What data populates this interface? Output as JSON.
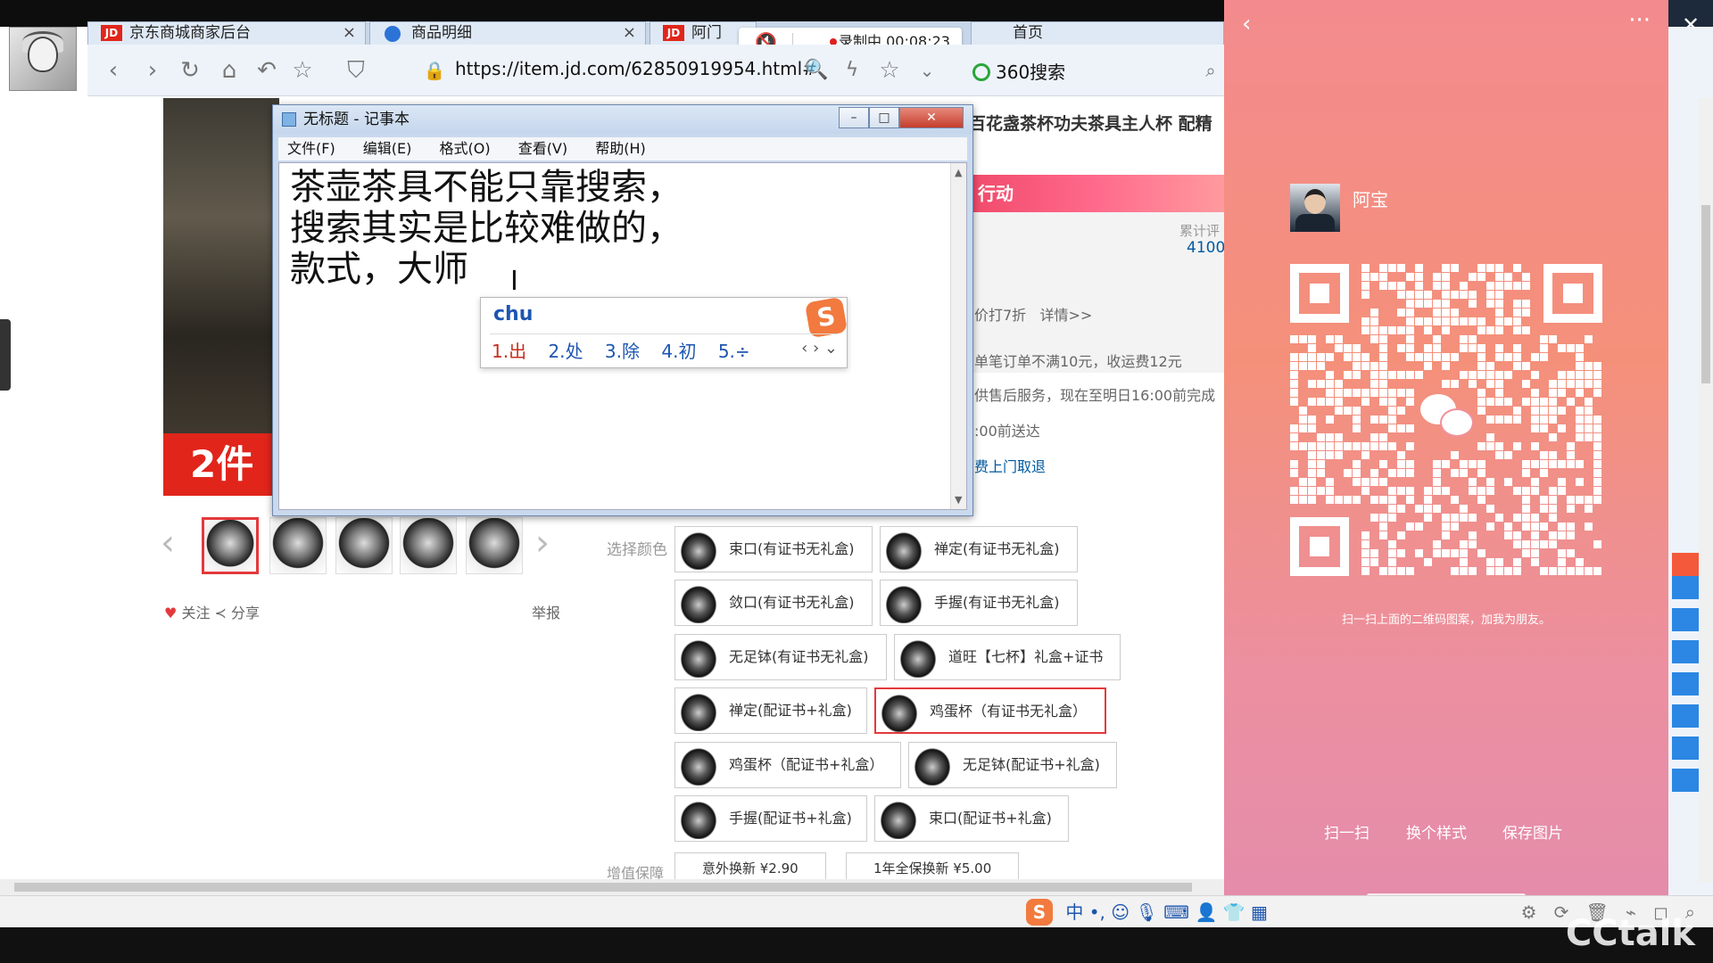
{
  "browser": {
    "tabs": [
      {
        "label": "京东商城商家后台"
      },
      {
        "label": "商品明细"
      },
      {
        "label": "阿门"
      },
      {
        "label": "首页"
      }
    ],
    "recording": {
      "label": "录制中 00:08:23"
    },
    "url": "https://item.jd.com/62850919954.html#",
    "search_engine": "360搜索"
  },
  "product": {
    "title": "百花盏茶杯功夫茶具主人杯 配精",
    "promo_text": "2件",
    "action_banner": "行动",
    "cumulative_label": "累计评",
    "cumulative_value": "4100",
    "discount_text": "价打7折",
    "details_link": "详情>>",
    "shipping_text": "单笔订单不满10元，收运费12元",
    "service_text": "供售后服务，现在至明日16:00前完成",
    "delivery_text": ":00前送达",
    "pickup_text": "费上门取退",
    "follow_label": "关注",
    "share_label": "分享",
    "report_label": "举报",
    "select_color_label": "选择颜色",
    "options": [
      {
        "label": "束口(有证书无礼盒)"
      },
      {
        "label": "禅定(有证书无礼盒)"
      },
      {
        "label": "敛口(有证书无礼盒)"
      },
      {
        "label": "手握(有证书无礼盒)"
      },
      {
        "label": "无足钵(有证书无礼盒)"
      },
      {
        "label": "道旺【七杯】礼盒+证书"
      },
      {
        "label": "禅定(配证书+礼盒)"
      },
      {
        "label": "鸡蛋杯（有证书无礼盒）"
      },
      {
        "label": "鸡蛋杯（配证书+礼盒）"
      },
      {
        "label": "无足钵(配证书+礼盒)"
      },
      {
        "label": "手握(配证书+礼盒)"
      },
      {
        "label": "束口(配证书+礼盒)"
      }
    ],
    "warranty_label": "增值保障",
    "warranty_options": [
      {
        "label": "意外换新 ¥2.90"
      },
      {
        "label": "1年全保换新 ¥5.00"
      }
    ]
  },
  "notepad": {
    "title": "无标题 - 记事本",
    "menu": [
      "文件(F)",
      "编辑(E)",
      "格式(O)",
      "查看(V)",
      "帮助(H)"
    ],
    "lines": [
      "茶壶茶具不能只靠搜索，",
      "搜索其实是比较难做的，",
      "款式，大师"
    ]
  },
  "ime": {
    "composition": "chu",
    "candidates": [
      "1.出",
      "2.处",
      "3.除",
      "4.初",
      "5.÷"
    ],
    "logo": "S"
  },
  "wechat": {
    "name": "阿宝",
    "hint": "扫一扫上面的二维码图案，加我为朋友。",
    "actions": [
      "扫一扫",
      "换个样式",
      "保存图片"
    ]
  },
  "statusbar": {
    "ime_mode": "中"
  },
  "watermark": "CCtalk"
}
